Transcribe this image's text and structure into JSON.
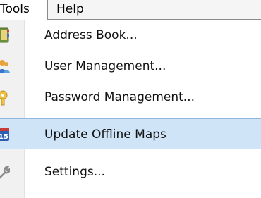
{
  "menubar": {
    "items": [
      {
        "label": "Tools"
      },
      {
        "label": "Help"
      }
    ]
  },
  "dropdown": {
    "items": [
      {
        "label": "Address Book...",
        "icon": "address-book-icon"
      },
      {
        "label": "User Management...",
        "icon": "users-icon"
      },
      {
        "label": "Password Management...",
        "icon": "key-icon"
      },
      {
        "label": "Update Offline Maps",
        "icon": "calendar-update-icon",
        "highlighted": true
      },
      {
        "label": "Settings...",
        "icon": "wrench-icon"
      }
    ]
  },
  "colors": {
    "highlight": "#cfe4f7",
    "highlight_border": "#8fb8df"
  }
}
